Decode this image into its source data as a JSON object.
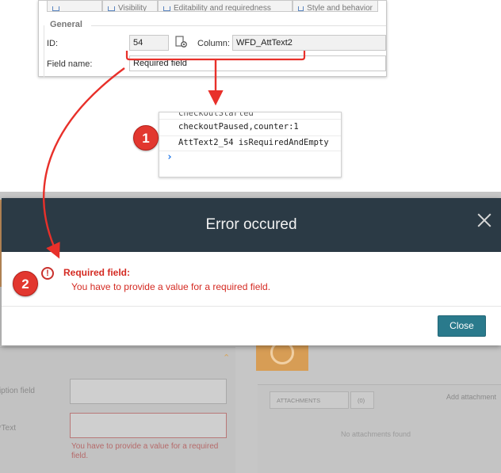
{
  "properties_panel": {
    "tabs": [
      {
        "label": "Visibility"
      },
      {
        "label": "Editability and requiredness"
      },
      {
        "label": "Style and behavior"
      }
    ],
    "group_title": "General",
    "id_label": "ID:",
    "id_value": "54",
    "column_label": "Column:",
    "column_value": "WFD_AttText2",
    "field_name_label": "Field name:",
    "field_name_value": "Required field"
  },
  "console": {
    "partial_line": "checkoutStarted",
    "lines": [
      "checkoutPaused,counter:1",
      "AttText2_54 isRequiredAndEmpty"
    ],
    "prompt": "›"
  },
  "badges": [
    "1",
    "2"
  ],
  "modal": {
    "title": "Error occured",
    "error_title": "Required field:",
    "error_message": "You have to provide a value for a required field.",
    "close_button": "Close",
    "error_icon": "exclamation-circle-icon",
    "close_icon": "close-x-icon"
  },
  "background_form": {
    "label_1": "Description field",
    "label_2": "Text*",
    "error_text": "You have to provide a value for a required field.",
    "tab_attachments": "ATTACHMENTS",
    "tab_other": "(0)",
    "add_attachment": "Add attachment",
    "empty_message": "No attachments found"
  },
  "colors": {
    "modal_header": "#2b3a45",
    "error_red": "#d42a22",
    "close_button": "#2a7a8c",
    "badge": "#e2372f",
    "arrow": "#e8302a"
  }
}
